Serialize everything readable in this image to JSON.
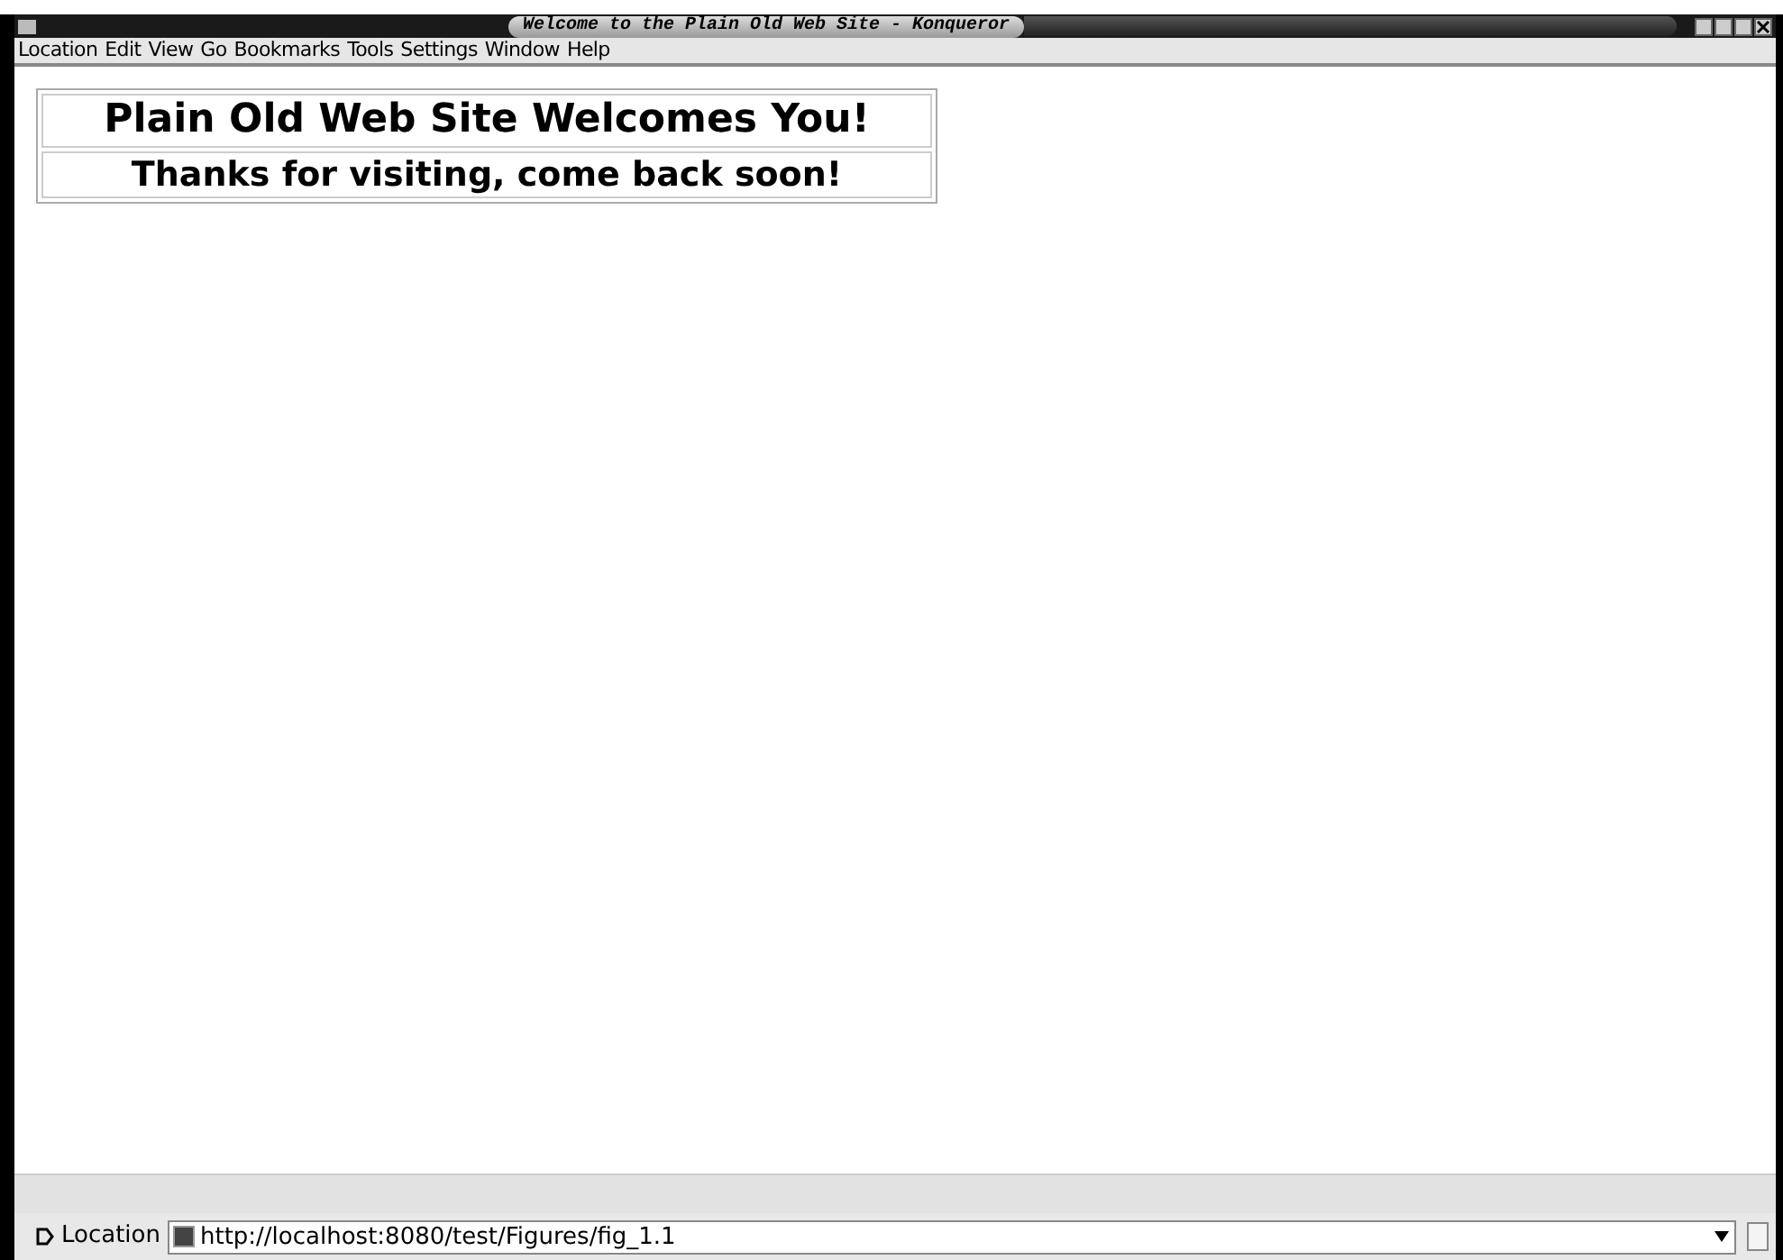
{
  "window": {
    "title": "Welcome to the Plain Old Web Site - Konqueror"
  },
  "menu_bar": [
    "Location",
    "Edit",
    "View",
    "Go",
    "Bookmarks",
    "Tools",
    "Settings",
    "Window",
    "Help"
  ],
  "page": {
    "rows": [
      "Plain Old Web Site Welcomes You!",
      "Thanks for visiting, come back soon!"
    ]
  },
  "location_bar": {
    "label": "Location",
    "value": "http://localhost:8080/test/Figures/fig_1.1"
  }
}
